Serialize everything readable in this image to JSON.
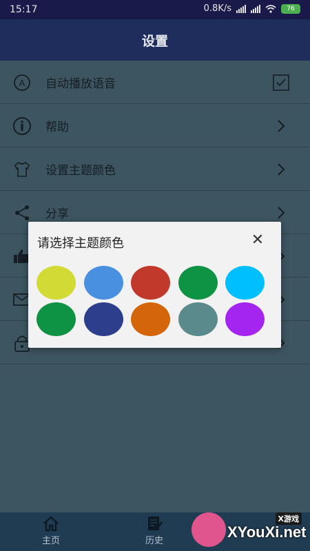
{
  "status_bar": {
    "time": "15:17",
    "speed": "0.8K/s",
    "battery": "76"
  },
  "header": {
    "title": "设置"
  },
  "settings": {
    "items": [
      {
        "label": "自动播放语音",
        "icon": "auto-play-icon",
        "trailing": "checkbox",
        "checked": true
      },
      {
        "label": "帮助",
        "icon": "info-icon",
        "trailing": "chevron"
      },
      {
        "label": "设置主题颜色",
        "icon": "tshirt-icon",
        "trailing": "chevron"
      },
      {
        "label": "分享",
        "icon": "share-icon",
        "trailing": "chevron"
      },
      {
        "label": "",
        "icon": "thumbs-up-icon",
        "trailing": "chevron"
      },
      {
        "label": "",
        "icon": "mail-icon",
        "trailing": "chevron"
      },
      {
        "label": "",
        "icon": "lock-icon",
        "trailing": "chevron"
      }
    ]
  },
  "dialog": {
    "title": "请选择主题颜色",
    "close_icon": "close-icon",
    "colors": [
      "#d2db35",
      "#4a90e0",
      "#c0392b",
      "#0e9344",
      "#00bfff",
      "#0e9344",
      "#2c3e8c",
      "#d4650a",
      "#5a8a8c",
      "#a425ef"
    ]
  },
  "bottom_nav": {
    "items": [
      {
        "label": "主页",
        "icon": "home-icon"
      },
      {
        "label": "历史",
        "icon": "history-icon"
      }
    ]
  },
  "watermark": {
    "text": "XYouXi.net",
    "badge_text": "X游戏"
  }
}
